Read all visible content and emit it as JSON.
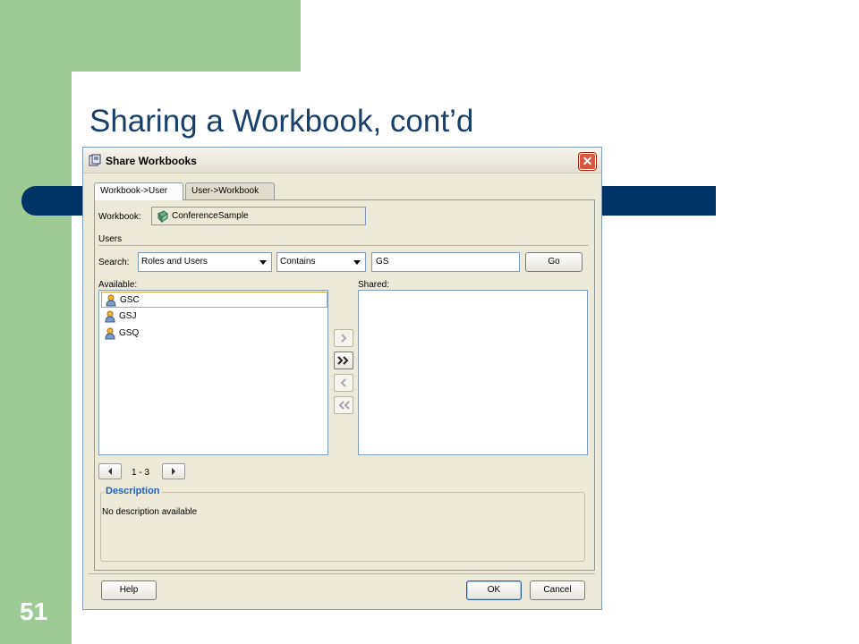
{
  "slide": {
    "title": "Sharing a Workbook, cont’d",
    "number": "51"
  },
  "dialog": {
    "title": "Share Workbooks",
    "icon": "share-workbook-icon",
    "close_icon": "close-icon",
    "tabs": [
      {
        "label": "Workbook->User",
        "active": true
      },
      {
        "label": "User->Workbook",
        "active": false
      }
    ],
    "workbook": {
      "label": "Workbook:",
      "value": "ConferenceSample",
      "icon": "workbook-icon"
    },
    "users_section": "Users",
    "search": {
      "label": "Search:",
      "type_selected": "Roles and Users",
      "operator_selected": "Contains",
      "query": "GS",
      "go_label": "Go"
    },
    "available": {
      "label": "Available:",
      "items": [
        {
          "name": "GSC",
          "selected": true
        },
        {
          "name": "GSJ",
          "selected": false
        },
        {
          "name": "GSQ",
          "selected": false
        }
      ]
    },
    "shared": {
      "label": "Shared:",
      "items": []
    },
    "move_buttons": [
      {
        "icon": "move-right-icon",
        "enabled": false
      },
      {
        "icon": "move-all-right-icon",
        "enabled": true
      },
      {
        "icon": "move-left-icon",
        "enabled": false
      },
      {
        "icon": "move-all-left-icon",
        "enabled": false
      }
    ],
    "pager": {
      "range": "1 - 3",
      "prev_icon": "previous-icon",
      "next_icon": "next-icon"
    },
    "description": {
      "legend": "Description",
      "text": "No description available"
    },
    "buttons": {
      "help": "Help",
      "ok": "OK",
      "cancel": "Cancel"
    }
  },
  "colors": {
    "slide_green": "#9dcb94",
    "slide_navy": "#003366",
    "title_blue": "#1a3f6b",
    "dialog_bg": "#ece9d8",
    "selection_border": "#e3a037",
    "legend_blue": "#1f5fbf"
  }
}
